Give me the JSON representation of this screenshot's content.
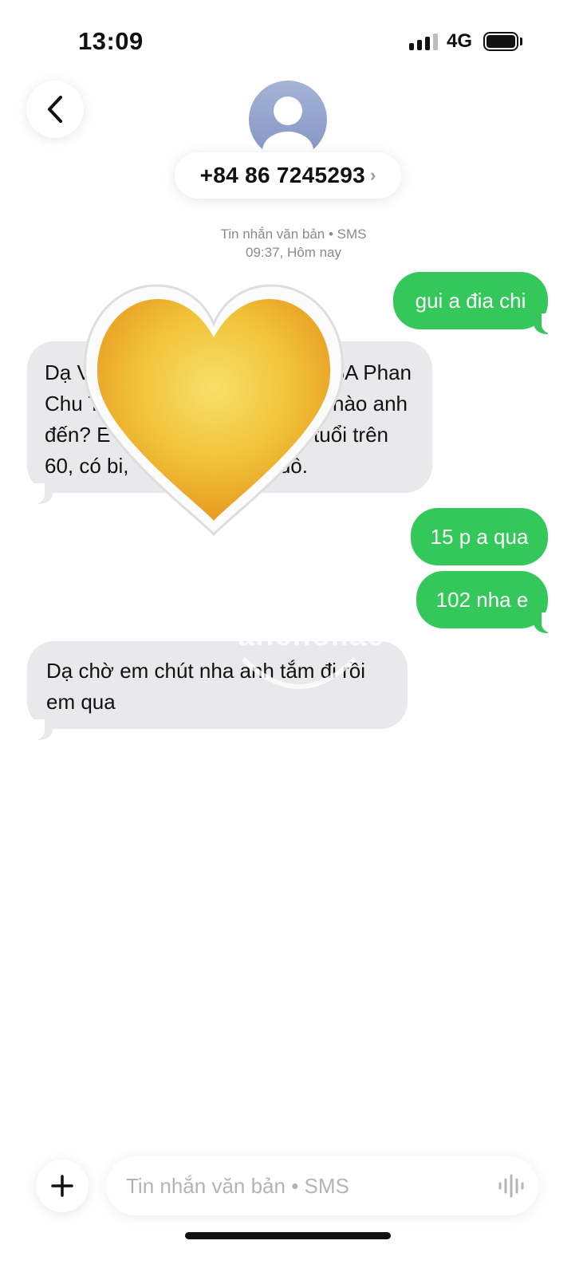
{
  "status_bar": {
    "time": "13:09",
    "network": "4G",
    "signal_icon": "cellular-signal-icon",
    "battery_icon": "battery-full-icon"
  },
  "header": {
    "back_icon": "chevron-left-icon",
    "avatar_icon": "person-silhouette-icon",
    "contact_number": "+84 86 7245293",
    "contact_chevron": "›"
  },
  "conversation": {
    "meta_line1": "Tin nhắn văn bản • SMS",
    "meta_line2": "09:37, Hôm nay",
    "messages": [
      {
        "direction": "outgoing",
        "lines": [
          "gui a đia chi"
        ]
      },
      {
        "direction": "incoming",
        "lines": [
          "Dạ V",
          "6A Phan",
          "Chu T",
          "nào anh",
          "đến? E",
          "tuổi trên",
          "60, có bi,",
          "đồ."
        ]
      },
      {
        "direction": "outgoing",
        "lines": [
          "15 p a qua"
        ]
      },
      {
        "direction": "outgoing",
        "lines": [
          "102 nha e"
        ]
      },
      {
        "direction": "incoming",
        "lines": [
          "Dạ chờ em chút nha anh tắm đi rồi",
          "em qua"
        ]
      }
    ],
    "overlay_icon": "yellow-heart-icon",
    "watermark": "anchoi.ac"
  },
  "composer": {
    "plus_icon": "plus-icon",
    "placeholder": "Tin nhắn văn bản • SMS",
    "mic_icon": "waveform-icon"
  },
  "colors": {
    "outgoing_bubble": "#34c759",
    "incoming_bubble": "#e9e9eb",
    "meta_text": "#8a8a8e",
    "heart": "#f3c23a"
  }
}
